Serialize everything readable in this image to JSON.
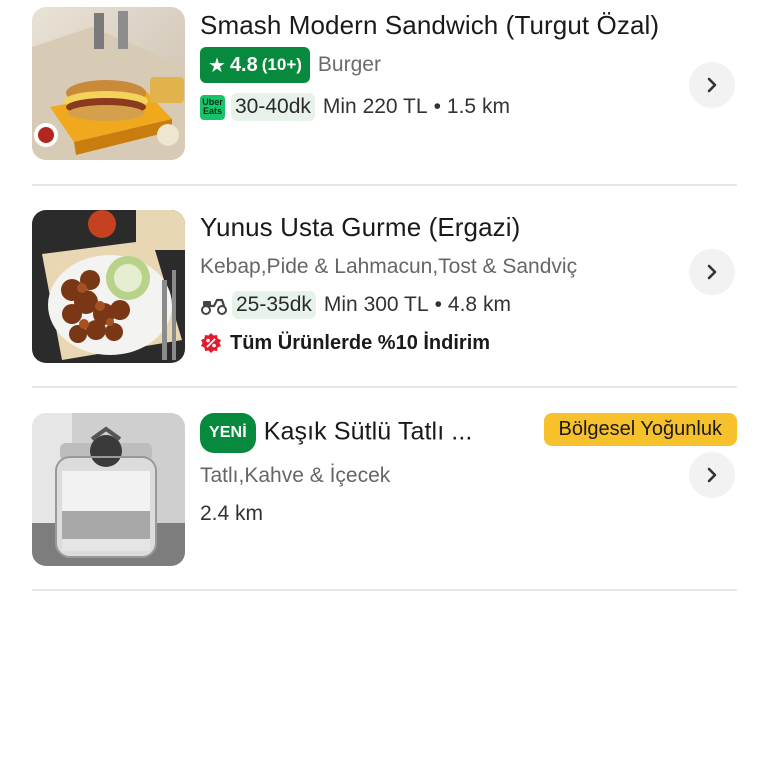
{
  "restaurants": [
    {
      "name": "Smash Modern Sandwich (Turgut Özal)",
      "rating": "4.8",
      "rating_count": "(10+)",
      "cuisine": "Burger",
      "ue_badge_top": "Uber",
      "ue_badge_bottom": "Eats",
      "delivery_time": "30-40dk",
      "min_order": "Min 220 TL",
      "separator": "•",
      "distance": "1.5 km",
      "thumb_icon": "sandwich-photo"
    },
    {
      "name": "Yunus Usta Gurme (Ergazi)",
      "cuisine": "Kebap,Pide & Lahmacun,Tost & Sandviç",
      "delivery_time": "25-35dk",
      "min_order": "Min 300 TL",
      "separator": "•",
      "distance": "4.8 km",
      "promo": "Tüm Ürünlerde %10 İndirim",
      "delivery_icon": "scooter-icon",
      "promo_icon": "discount-icon",
      "thumb_icon": "kebab-photo"
    },
    {
      "new_badge": "YENİ",
      "name": "Kaşık Sütlü Tatlı ...",
      "load_badge": "Bölgesel Yoğunluk",
      "cuisine": "Tatlı,Kahve & İçecek",
      "distance": "2.4 km",
      "thumb_icon": "dessert-photo"
    }
  ],
  "colors": {
    "brand_green": "#078a3d",
    "ue_green": "#16c46a",
    "load_yellow": "#f6c12b",
    "promo_red": "#e21b2c"
  }
}
